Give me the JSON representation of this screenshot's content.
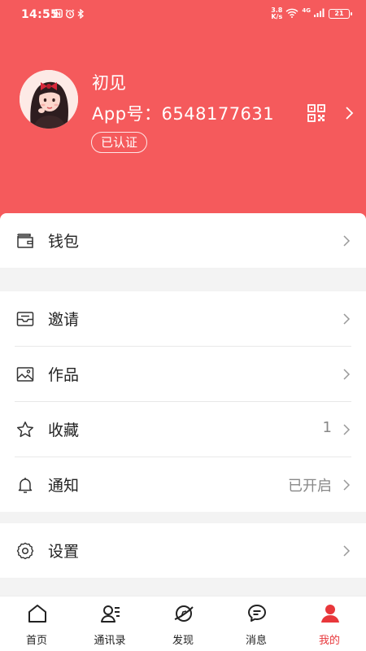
{
  "status": {
    "time": "14:55",
    "net_speed_value": "3.8",
    "net_speed_unit": "K/s",
    "network": "4G",
    "battery": "21",
    "left_icons": [
      "nfc-icon",
      "alarm-icon",
      "bluetooth-icon"
    ]
  },
  "profile": {
    "name": "初见",
    "app_id": "App号：6548177631",
    "verified": "已认证"
  },
  "colors": {
    "header_bg": "#f55a5c",
    "active_tab": "#e8373b"
  },
  "menu": {
    "wallet": "钱包",
    "invite": "邀请",
    "works": "作品",
    "favorites": "收藏",
    "favorites_count": "1",
    "notify": "通知",
    "notify_status": "已开启",
    "settings": "设置"
  },
  "tabs": [
    {
      "label": "首页",
      "icon": "home-icon"
    },
    {
      "label": "通讯录",
      "icon": "contacts-icon"
    },
    {
      "label": "发现",
      "icon": "discover-icon"
    },
    {
      "label": "消息",
      "icon": "message-icon"
    },
    {
      "label": "我的",
      "icon": "profile-icon",
      "active": true
    }
  ]
}
